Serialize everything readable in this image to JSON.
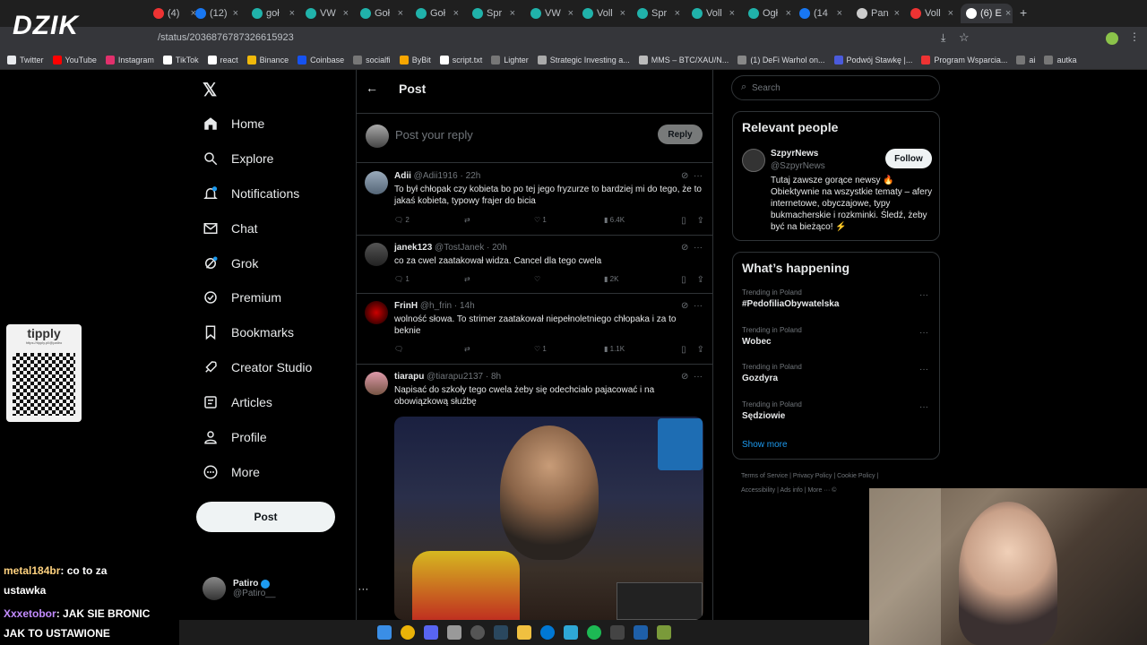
{
  "browser": {
    "tabs": [
      {
        "label": "(4)",
        "color": "#e33"
      },
      {
        "label": "(12)",
        "color": "#1877f2"
      },
      {
        "label": "goł",
        "color": "#20b2aa"
      },
      {
        "label": "VW",
        "color": "#20b2aa"
      },
      {
        "label": "Goł",
        "color": "#20b2aa"
      },
      {
        "label": "Goł",
        "color": "#20b2aa"
      },
      {
        "label": "Spr",
        "color": "#20b2aa"
      },
      {
        "label": "VW",
        "color": "#20b2aa"
      },
      {
        "label": "Voll",
        "color": "#20b2aa"
      },
      {
        "label": "Spr",
        "color": "#20b2aa"
      },
      {
        "label": "Voll",
        "color": "#20b2aa"
      },
      {
        "label": "Ogł",
        "color": "#20b2aa"
      },
      {
        "label": "(14",
        "color": "#1877f2"
      },
      {
        "label": "Pan",
        "color": "#ccc"
      },
      {
        "label": "Voll",
        "color": "#e33"
      },
      {
        "label": "(6) E",
        "color": "#fff"
      }
    ],
    "url": "/status/2036876787326615923",
    "bookmarks": [
      "Twitter",
      "YouTube",
      "Instagram",
      "TikTok",
      "react",
      "Binance",
      "Coinbase",
      "socialfi",
      "ByBit",
      "script.txt",
      "Lighter",
      "Strategic Investing a...",
      "MMS – BTC/XAU/N...",
      "(1) DeFi Warhol on...",
      "Podwój Stawkę |...",
      "Program Wsparcia...",
      "ai",
      "autka"
    ]
  },
  "overlay": {
    "logo": "DZIK",
    "tipply_label": "tipply",
    "tipply_url": "https://tipply.pl/@patiro",
    "chat": [
      {
        "user": "metal184br",
        "text": ": co to za",
        "cont": "ustawka",
        "user_color": "#ffd27f"
      },
      {
        "user": "Xxxetobor",
        "text": ": JAK SIE BRONIC",
        "cont": "JAK TO USTAWIONE",
        "user_color": "#c38cff"
      }
    ]
  },
  "nav": {
    "items": [
      {
        "label": "Home",
        "icon": "home-icon"
      },
      {
        "label": "Explore",
        "icon": "search-icon"
      },
      {
        "label": "Notifications",
        "icon": "bell-icon"
      },
      {
        "label": "Chat",
        "icon": "mail-icon"
      },
      {
        "label": "Grok",
        "icon": "grok-icon"
      },
      {
        "label": "Premium",
        "icon": "premium-icon"
      },
      {
        "label": "Bookmarks",
        "icon": "bookmark-icon"
      },
      {
        "label": "Creator Studio",
        "icon": "rocket-icon"
      },
      {
        "label": "Articles",
        "icon": "article-icon"
      },
      {
        "label": "Profile",
        "icon": "profile-icon"
      },
      {
        "label": "More",
        "icon": "more-icon"
      }
    ],
    "post_label": "Post",
    "user_name": "Patiro",
    "user_handle": "@Patiro__"
  },
  "main": {
    "title": "Post",
    "reply_placeholder": "Post your reply",
    "reply_label": "Reply",
    "tweets": [
      {
        "name": "Adii",
        "handle": "@Adii1916",
        "time": "22h",
        "text": "To był chłopak czy kobieta bo po tej jego fryzurze to bardziej mi do tego, że to jakaś kobieta, typowy frajer do bicia",
        "replies": "2",
        "retweets": "",
        "likes": "1",
        "views": "6.4K"
      },
      {
        "name": "janek123",
        "handle": "@TostJanek",
        "time": "20h",
        "text": "co za cwel zaatakował widza. Cancel dla tego cwela",
        "replies": "1",
        "retweets": "",
        "likes": "",
        "views": "2K"
      },
      {
        "name": "FrinH",
        "handle": "@h_frin",
        "time": "14h",
        "text": "wolność słowa. To strimer zaatakował niepełnoletniego chłopaka i za to beknie",
        "replies": "",
        "retweets": "",
        "likes": "1",
        "views": "1.1K"
      },
      {
        "name": "tiarapu",
        "handle": "@tiarapu2137",
        "time": "8h",
        "text": "Napisać do szkoły tego cwela żeby się odechciało pajacować i na obowiązkową służbę",
        "replies": "",
        "retweets": "",
        "likes": "",
        "views": ""
      }
    ]
  },
  "sidebar": {
    "search_placeholder": "Search",
    "relevant_title": "Relevant people",
    "person_name": "SzpyrNews",
    "person_handle": "@SzpyrNews",
    "follow_label": "Follow",
    "person_bio": "Tutaj zawsze gorące newsy 🔥 Obiektywnie na wszystkie tematy – afery internetowe, obyczajowe, typy bukmacherskie i rozkminki. Śledź, żeby być na bieżąco! ⚡",
    "happening_title": "What’s happening",
    "trends": [
      {
        "category": "Trending in Poland",
        "name": "#PedofiliaObywatelska"
      },
      {
        "category": "Trending in Poland",
        "name": "Wobec"
      },
      {
        "category": "Trending in Poland",
        "name": "Gozdyra"
      },
      {
        "category": "Trending in Poland",
        "name": "Sędziowie"
      }
    ],
    "show_more": "Show more",
    "footer1": "Terms of Service  |  Privacy Policy  |  Cookie Policy  |",
    "footer2": "Accessibility  |  Ads info  |  More ···  ©"
  }
}
